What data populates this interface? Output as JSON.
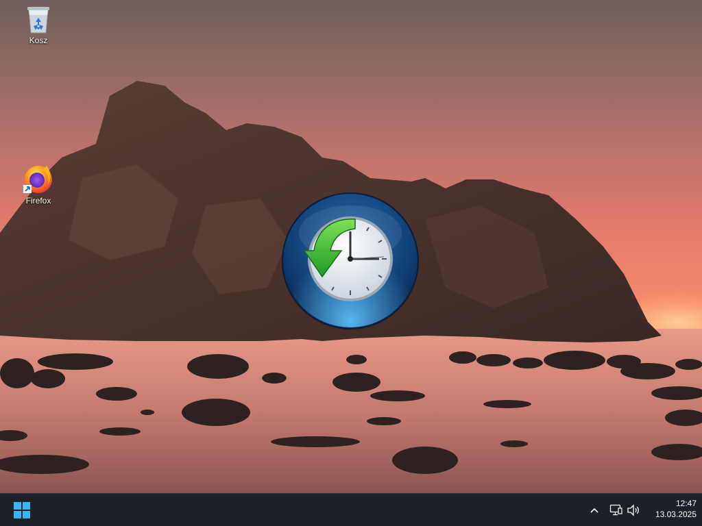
{
  "desktop": {
    "icons": [
      {
        "label": "Kosz",
        "icon": "recycle-bin-icon"
      },
      {
        "label": "Firefox",
        "icon": "firefox-icon"
      }
    ],
    "center_overlay": {
      "icon": "clock-restore-icon"
    }
  },
  "taskbar": {
    "start_icon": "windows-logo-icon",
    "tray": {
      "chevron_icon": "chevron-up-icon",
      "network_icon": "network-icon",
      "volume_icon": "volume-icon"
    },
    "clock": {
      "time": "12:47",
      "date": "13.03.2025"
    }
  },
  "colors": {
    "taskbar_bg": "#1c2128",
    "start_accent": "#3ab4f2",
    "arrow_green": "#2fb52f",
    "orb_blue": "#1e5a9a"
  }
}
